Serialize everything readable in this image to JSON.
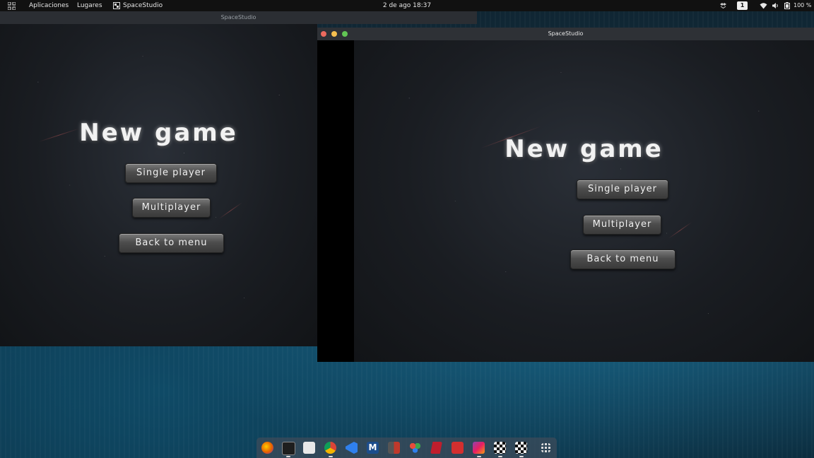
{
  "topbar": {
    "applications_label": "Aplicaciones",
    "places_label": "Lugares",
    "active_app_label": "SpaceStudio",
    "clock": "2 de ago  18:37",
    "workspace_number": "1",
    "battery_text": "100 %"
  },
  "back_window": {
    "title": "SpaceStudio",
    "game": {
      "heading": "New game",
      "single_player_label": "Single player",
      "multiplayer_label": "Multiplayer",
      "back_label": "Back to menu"
    }
  },
  "front_window": {
    "title": "SpaceStudio",
    "game": {
      "heading": "New game",
      "single_player_label": "Single player",
      "multiplayer_label": "Multiplayer",
      "back_label": "Back to menu"
    }
  },
  "dock": {
    "icons": [
      {
        "name": "firefox-icon",
        "color": "#e66000"
      },
      {
        "name": "terminal-icon",
        "color": "#1e1e1e"
      },
      {
        "name": "files-icon",
        "color": "#e8e8e8"
      },
      {
        "name": "chrome-icon",
        "color": "#db4437"
      },
      {
        "name": "vscode-icon",
        "color": "#2f80ed"
      },
      {
        "name": "mendeley-icon",
        "color": "#1c4d8c"
      },
      {
        "name": "book-icon",
        "color": "#c0392b"
      },
      {
        "name": "davinci-icon",
        "color": "#3fa34d"
      },
      {
        "name": "filezilla-icon",
        "color": "#bf1e2d"
      },
      {
        "name": "red-app-icon",
        "color": "#d32f2f"
      },
      {
        "name": "intellij-icon",
        "color": "#8e44ad"
      },
      {
        "name": "spacestudio-icon-1",
        "color": "#f0f0f0"
      },
      {
        "name": "spacestudio-icon-2",
        "color": "#f0f0f0"
      },
      {
        "name": "show-apps-icon",
        "color": "#dddddd"
      }
    ]
  },
  "colors": {
    "topbar_bg": "#111111",
    "close": "#ed6a5e",
    "minimize": "#f5bf4f",
    "maximize": "#61c554"
  }
}
